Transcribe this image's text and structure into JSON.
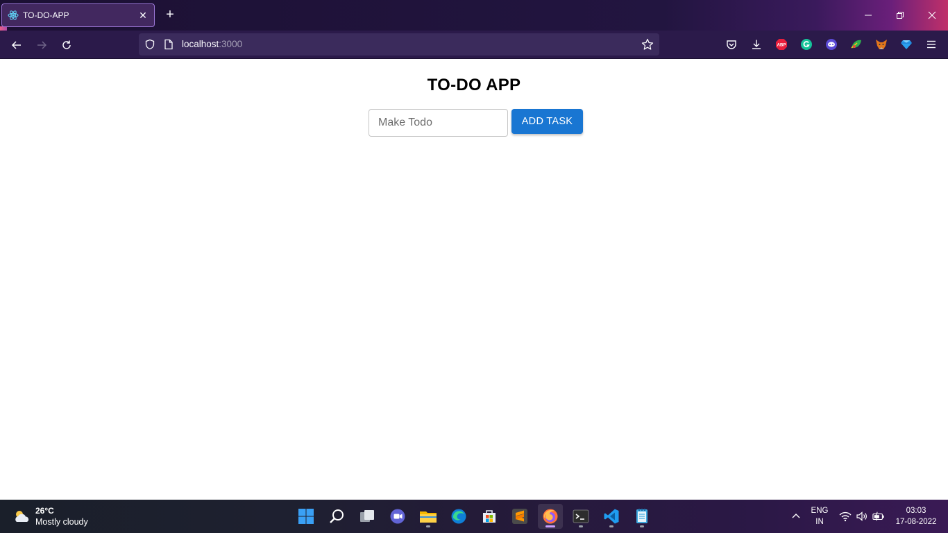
{
  "browser": {
    "tab": {
      "title": "TO-DO-APP",
      "close_icon": "close-icon",
      "favicon": "react-icon"
    },
    "new_tab_label": "+",
    "url": {
      "host": "localhost",
      "port": ":3000"
    }
  },
  "page": {
    "title": "TO-DO APP",
    "input": {
      "placeholder": "Make Todo",
      "value": ""
    },
    "add_button_label": "ADD TASK"
  },
  "taskbar": {
    "weather": {
      "temp": "26°C",
      "desc": "Mostly cloudy"
    },
    "language": {
      "line1": "ENG",
      "line2": "IN"
    },
    "clock": {
      "time": "03:03",
      "date": "17-08-2022"
    }
  },
  "colors": {
    "accent_button": "#1976d2",
    "tab_border": "#9b76d6",
    "toolbar": "#2b1a4a"
  }
}
